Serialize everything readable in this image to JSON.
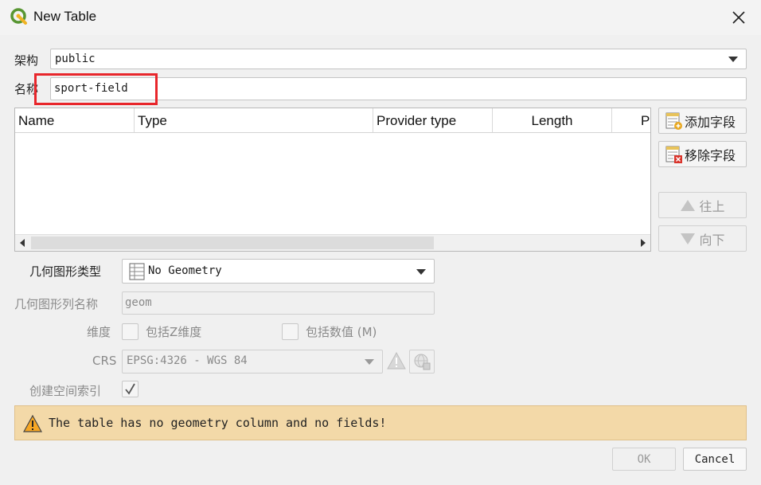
{
  "window": {
    "title": "New Table"
  },
  "schema": {
    "label": "架构",
    "value": "public"
  },
  "name": {
    "label": "名称",
    "value": "sport-field"
  },
  "fields_table": {
    "columns": [
      "Name",
      "Type",
      "Provider type",
      "Length",
      "P"
    ],
    "rows": []
  },
  "field_buttons": {
    "add": "添加字段",
    "remove": "移除字段",
    "up": "往上",
    "down": "向下"
  },
  "geometry": {
    "type_label": "几何图形类型",
    "type_value": "No Geometry",
    "column_label": "几何图形列名称",
    "column_value": "geom",
    "dimension_label": "维度",
    "include_z": "包括Z维度",
    "include_m": "包括数值 (M)",
    "crs_label": "CRS",
    "crs_value": "EPSG:4326 - WGS 84",
    "spatial_index_label": "创建空间索引",
    "spatial_index_checked": true
  },
  "warning": {
    "message": "The table has no geometry column and no fields!"
  },
  "buttons": {
    "ok": "OK",
    "cancel": "Cancel"
  },
  "colors": {
    "warning_bg": "#f3d9a8",
    "highlight": "#e8262b",
    "qgis_green": "#589632"
  }
}
